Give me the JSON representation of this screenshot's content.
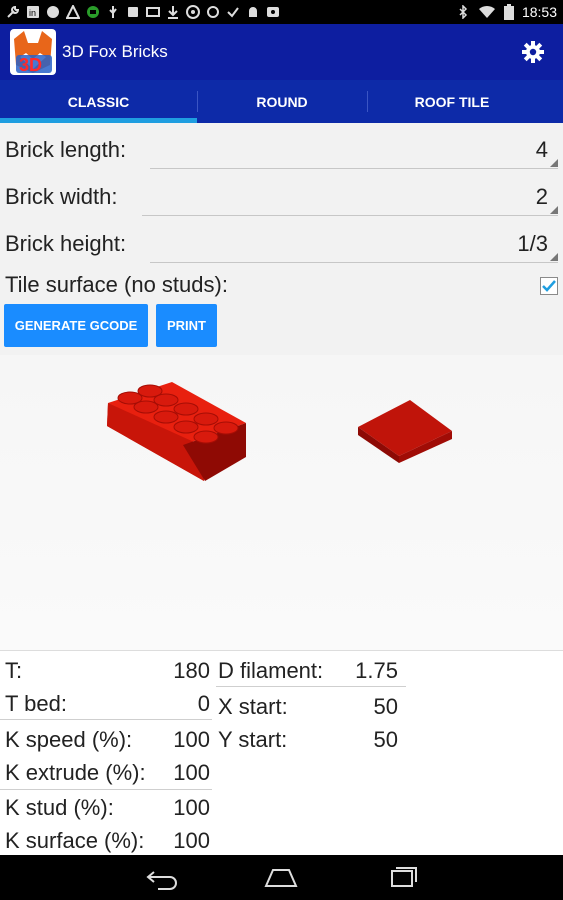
{
  "status_bar": {
    "time": "18:53",
    "left_icons": [
      "wrench-icon",
      "linkedin-icon",
      "leaf-icon",
      "triangle-icon",
      "grid-icon",
      "usb-icon",
      "square-icon",
      "media-icon",
      "download-icon",
      "target-icon",
      "circle-icon",
      "check-icon",
      "android-icon",
      "image-icon"
    ],
    "right_icons": [
      "bluetooth-icon",
      "wifi-icon",
      "battery-icon"
    ]
  },
  "app": {
    "title": "3D Fox Bricks",
    "icon_text": "3D"
  },
  "tabs": [
    {
      "label": "CLASSIC",
      "selected": true
    },
    {
      "label": "ROUND",
      "selected": false
    },
    {
      "label": "ROOF TILE",
      "selected": false
    }
  ],
  "form": {
    "length_label": "Brick length:",
    "length_value": "4",
    "width_label": "Brick width:",
    "width_value": "2",
    "height_label": "Brick height:",
    "height_value": "1/3",
    "tile_label": "Tile surface (no studs):",
    "tile_checked": true
  },
  "buttons": {
    "generate": "GENERATE GCODE",
    "print": "PRINT"
  },
  "params": {
    "t_label": "T:",
    "t_value": "180",
    "tbed_label": "T bed:",
    "tbed_value": "0",
    "kspeed_label": "K speed (%):",
    "kspeed_value": "100",
    "kextrude_label": "K extrude (%):",
    "kextrude_value": "100",
    "kstud_label": "K stud (%):",
    "kstud_value": "100",
    "ksurface_label": "K surface (%):",
    "ksurface_value": "100",
    "dfil_label": "D filament:",
    "dfil_value": "1.75",
    "xstart_label": "X start:",
    "xstart_value": "50",
    "ystart_label": "Y start:",
    "ystart_value": "50"
  },
  "colors": {
    "actionbar": "#0d1ea0",
    "tabs": "#0d2aa8",
    "tab_indicator": "#1f9ee0",
    "button": "#1a8cff",
    "brick": "#e01b10",
    "checkbox": "#1f9ee0"
  }
}
